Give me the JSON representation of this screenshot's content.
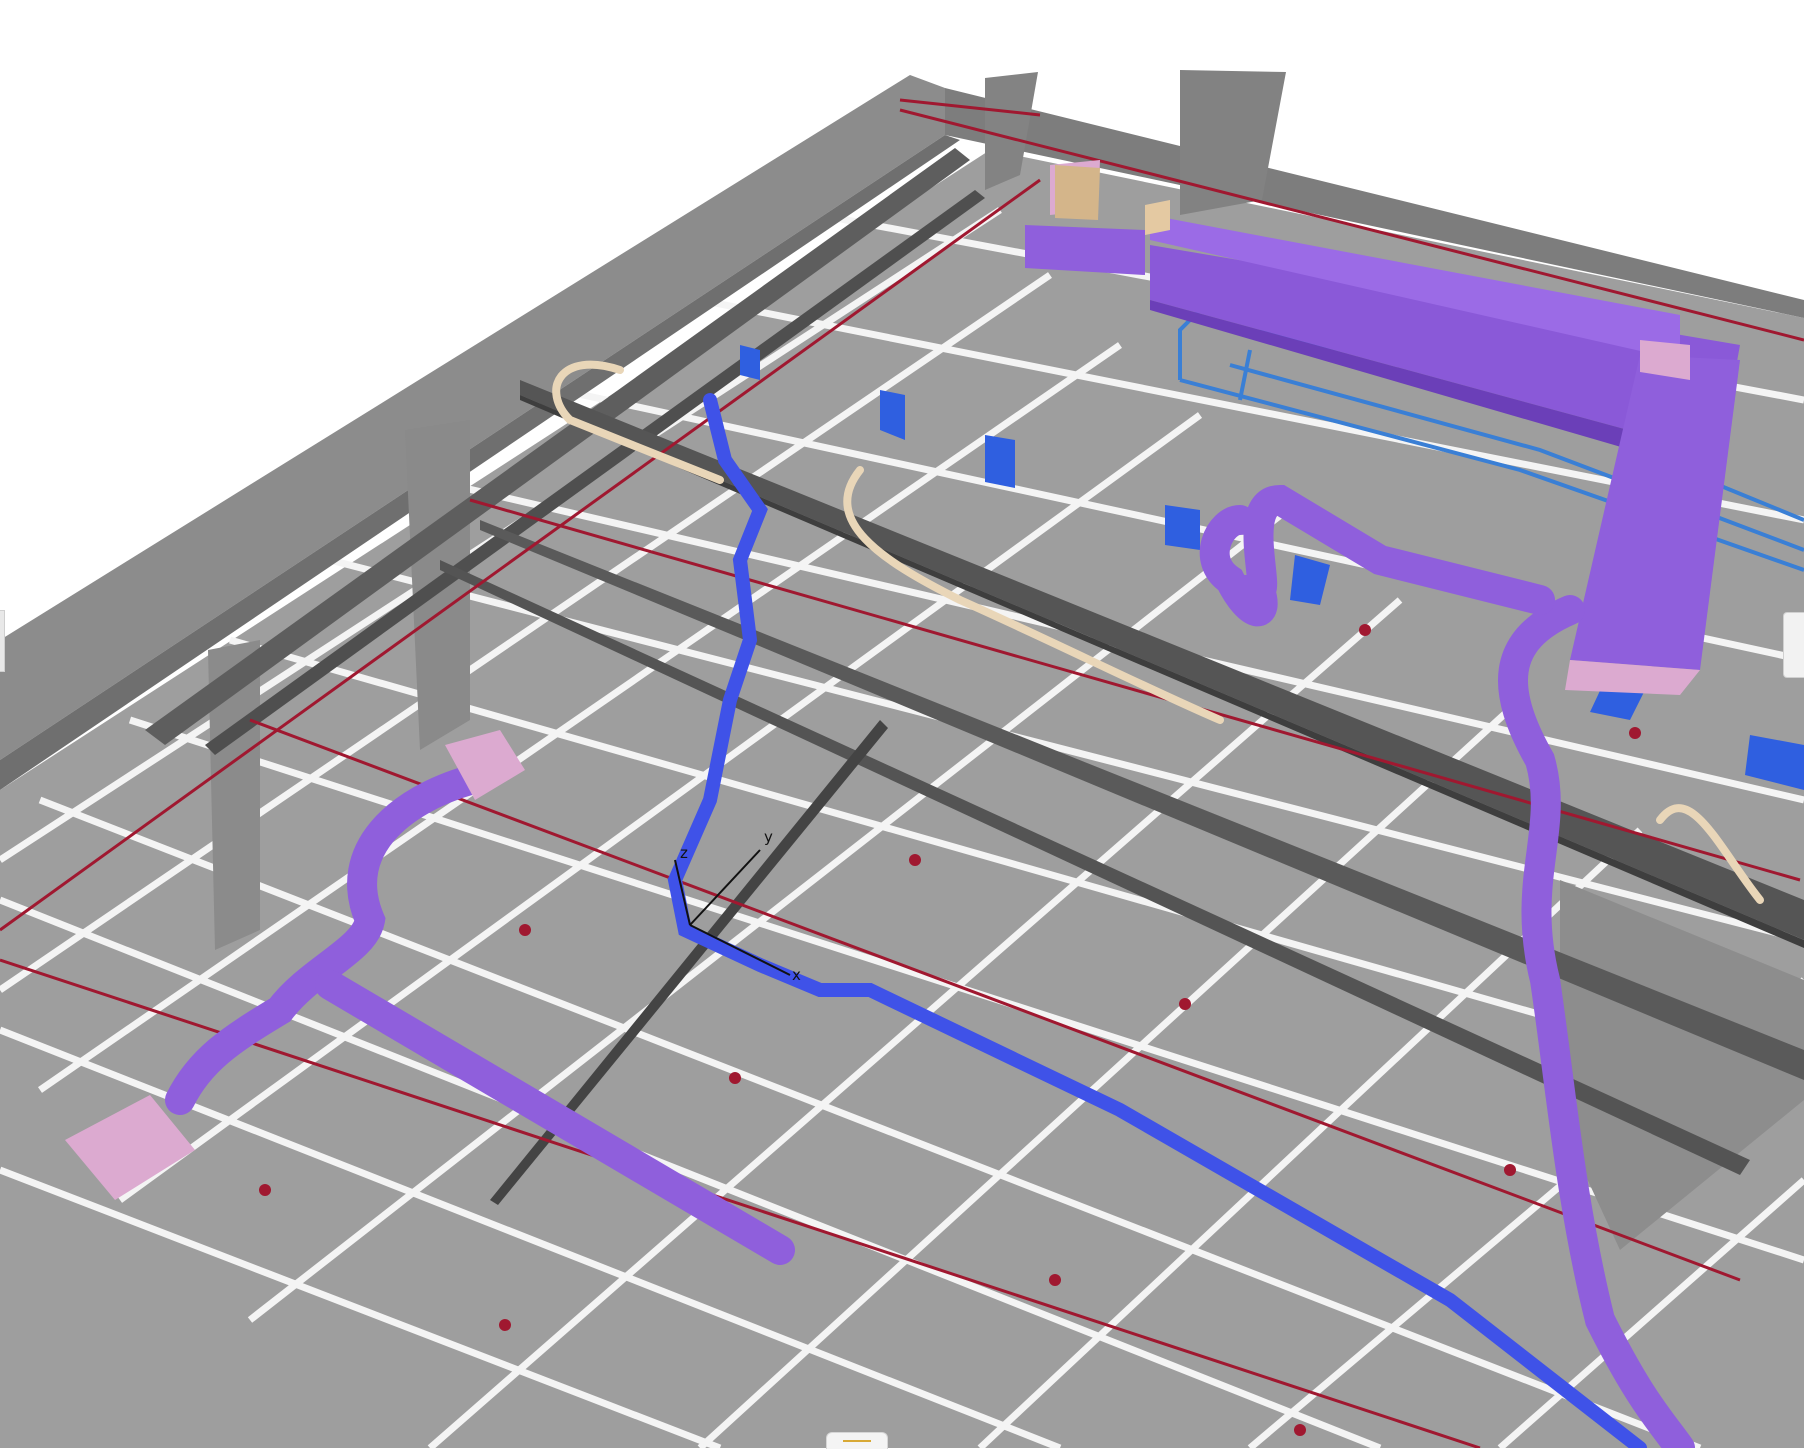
{
  "viewer": {
    "background_color": "#ffffff",
    "ceiling_tile_color": "#9e9e9e",
    "grid_color": "#f4f4f4",
    "wall_color": "#8c8c8c",
    "beam_color": "#555555",
    "sprinkler_pipe_color": "#a01830",
    "duct_color": "#8f5fdc",
    "selected_pipe_color": "#3f52e8",
    "water_pipe_color": "#3a7fd5",
    "flex_duct_color": "#e9d6b8",
    "diffuser_color": "#dcaad0",
    "light_fixture_color": "#2f5fe0"
  },
  "axis_triad": {
    "x_label": "x",
    "y_label": "y",
    "z_label": "z"
  },
  "ui": {
    "left_panel_tab_icon": "panel-collapse-icon",
    "right_panel_tab_icon": "panel-expand-icon",
    "bottom_drawer_icon": "drawer-handle-icon"
  }
}
